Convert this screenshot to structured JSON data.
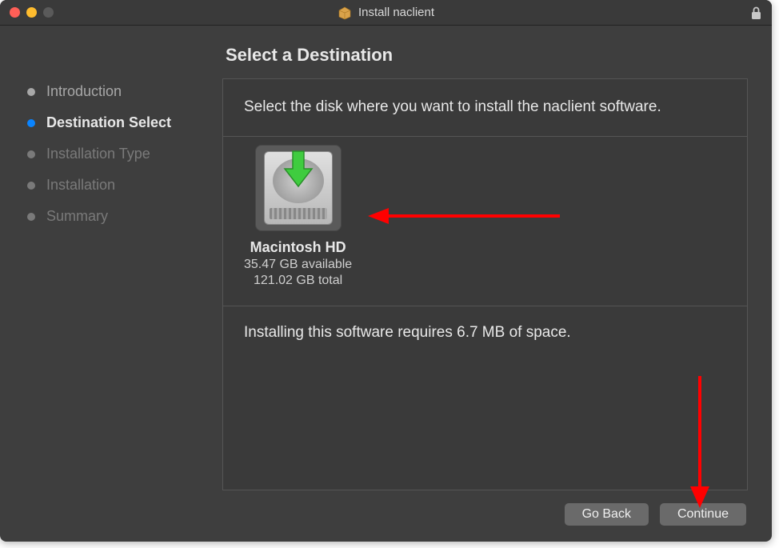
{
  "titlebar": {
    "title": "Install naclient"
  },
  "sidebar": {
    "steps": [
      {
        "label": "Introduction",
        "state": "done"
      },
      {
        "label": "Destination Select",
        "state": "active"
      },
      {
        "label": "Installation Type",
        "state": "pending"
      },
      {
        "label": "Installation",
        "state": "pending"
      },
      {
        "label": "Summary",
        "state": "pending"
      }
    ]
  },
  "main": {
    "heading": "Select a Destination",
    "instruction": "Select the disk where you want to install the naclient software.",
    "disk": {
      "name": "Macintosh HD",
      "available": "35.47 GB available",
      "total": "121.02 GB total"
    },
    "footer": "Installing this software requires 6.7 MB of space."
  },
  "buttons": {
    "back": "Go Back",
    "continue": "Continue"
  },
  "colors": {
    "accent_blue": "#0a84ff",
    "arrow_red": "#ff0000",
    "arrow_green": "#3fcc3f"
  }
}
